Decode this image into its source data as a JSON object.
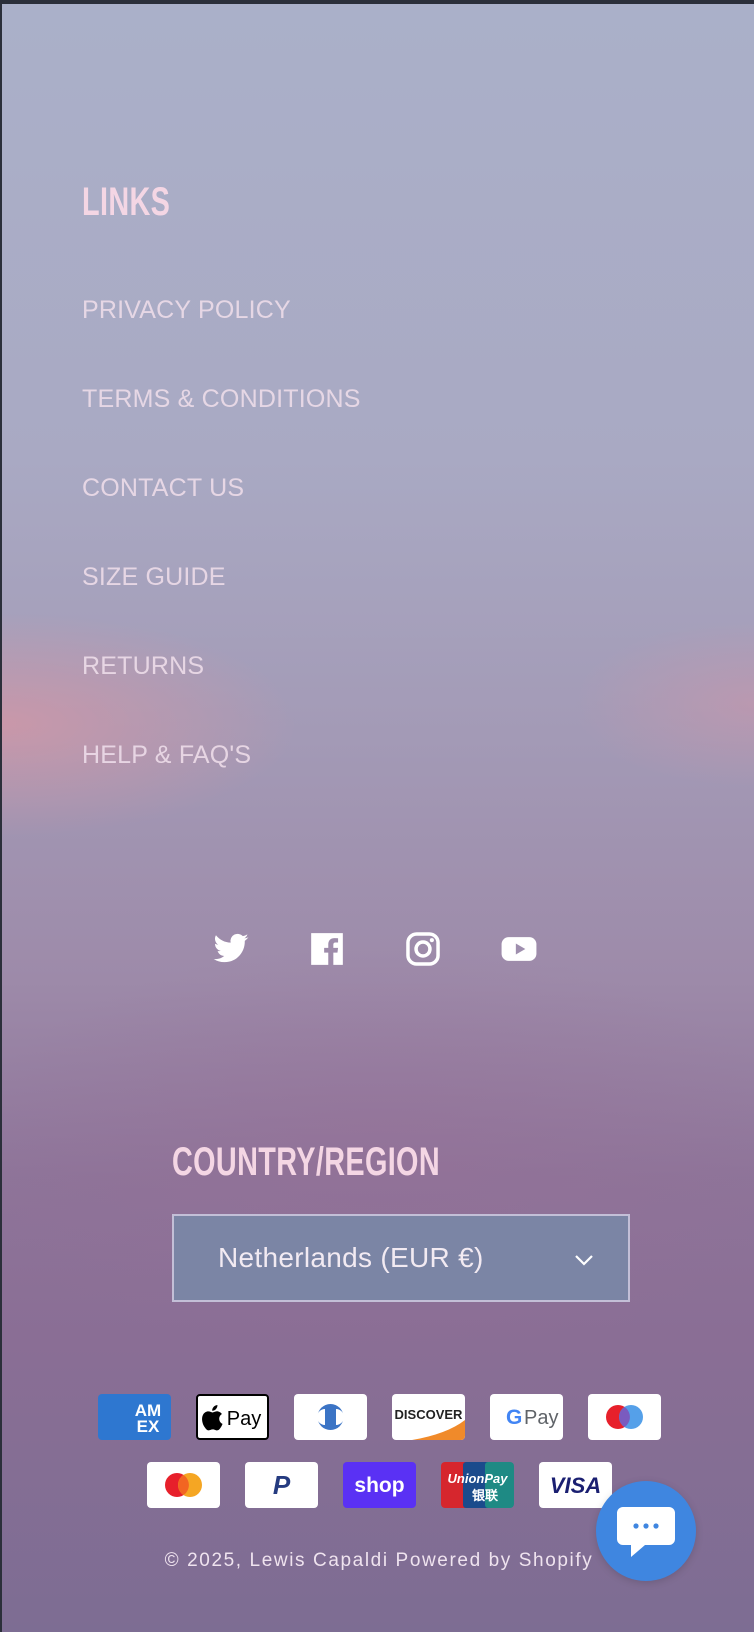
{
  "links_section": {
    "heading": "LINKS",
    "items": [
      {
        "label": "PRIVACY POLICY"
      },
      {
        "label": "TERMS & CONDITIONS"
      },
      {
        "label": "CONTACT US"
      },
      {
        "label": "SIZE GUIDE"
      },
      {
        "label": "RETURNS"
      },
      {
        "label": "HELP & FAQ'S"
      }
    ]
  },
  "social": {
    "icons": [
      "twitter-icon",
      "facebook-icon",
      "instagram-icon",
      "youtube-icon"
    ]
  },
  "country": {
    "heading": "COUNTRY/REGION",
    "selected": "Netherlands (EUR €)"
  },
  "payments": {
    "row1": [
      "American Express",
      "Apple Pay",
      "Diners Club",
      "Discover",
      "Google Pay",
      "Maestro"
    ],
    "row2": [
      "Mastercard",
      "PayPal",
      "Shop Pay",
      "Union Pay",
      "Visa"
    ],
    "labels": {
      "amex": "AM EX",
      "applepay": "Pay",
      "discover": "DISCOVER",
      "gpay": "Pay",
      "shop": "shop",
      "unionpay": "UnionPay",
      "unionpay_cn": "银联",
      "visa": "VISA"
    }
  },
  "footer": {
    "copyright": "© 2025, Lewis Capaldi",
    "powered": "Powered by Shopify"
  },
  "colors": {
    "accent": "#3f86e0",
    "heading": "#f4d6e4",
    "select_bg": "#7b85a5"
  }
}
